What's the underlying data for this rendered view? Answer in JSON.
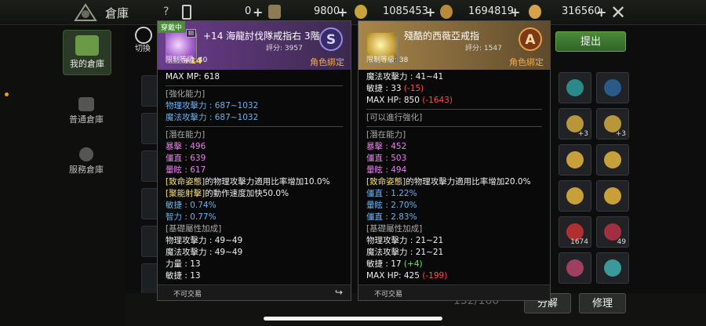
{
  "topbar": {
    "title": "倉庫",
    "help": "?",
    "resources": [
      {
        "value": "0",
        "color": "#b8a27a"
      },
      {
        "value": "9800",
        "color": "#d8b24a"
      },
      {
        "value": "1085453",
        "color": "#c9a24a"
      },
      {
        "value": "1694819",
        "color": "#d4a24c"
      },
      {
        "value": "316560",
        "color": "#cfa04a"
      }
    ]
  },
  "sidebar": {
    "switch_label": "切換",
    "items": [
      {
        "label": "我的倉庫",
        "icon": "crate-icon"
      },
      {
        "label": "普通倉庫",
        "icon": "building-icon"
      },
      {
        "label": "服務倉庫",
        "icon": "plus-circle-icon"
      }
    ]
  },
  "right_grid": {
    "counts": [
      "+3",
      "+3",
      "1674",
      "49"
    ]
  },
  "bottom": {
    "counter": "152/160",
    "withdraw_label": "提出",
    "dismantle_label": "分解",
    "repair_label": "修理"
  },
  "left_panel": {
    "equipped": "穿戴中",
    "tier": "III",
    "plus": "+14",
    "name": "+14 海龍討伐隊戒指右 3階",
    "score": "評分: 3957",
    "grade": "S",
    "req": "限制等級:  40",
    "bind": "角色綁定",
    "lines": [
      {
        "text": "MAX MP:  618",
        "color": "white"
      },
      {
        "sep": true
      },
      {
        "text": "[強化能力]",
        "color": "grey"
      },
      {
        "text": "物理攻擊力 : 687~1032",
        "color": "blue"
      },
      {
        "text": "魔法攻擊力 : 687~1032",
        "color": "blue"
      },
      {
        "sep": true
      },
      {
        "text": "[潛在能力]",
        "color": "grey"
      },
      {
        "text": "暴擊 : 496",
        "color": "pink"
      },
      {
        "text": "僵直 : 639",
        "color": "pink"
      },
      {
        "text": "暈眩 : 617",
        "color": "pink"
      },
      {
        "text": "[致命姿態]",
        "color": "yellow",
        "rest": "的物理攻擊力適用比率增加10.0%",
        "rest_color": "white"
      },
      {
        "text": "[聚能射擊]",
        "color": "yellow",
        "rest": "的動作速度加快50.0%",
        "rest_color": "white"
      },
      {
        "text": "敏捷 : 0.74%",
        "color": "blue"
      },
      {
        "text": "智力 : 0.77%",
        "color": "blue"
      },
      {
        "text": "[基礎屬性加成]",
        "color": "grey"
      },
      {
        "text": "物理攻擊力 : 49~49",
        "color": "white"
      },
      {
        "text": "魔法攻擊力 : 49~49",
        "color": "white"
      },
      {
        "text": "力量 : 13",
        "color": "white"
      },
      {
        "text": "敏捷 : 13",
        "color": "white"
      }
    ],
    "foot": "不可交易"
  },
  "right_panel": {
    "name": "殘酷的西薇亞戒指",
    "score": "評分: 1547",
    "grade": "A",
    "req": "限制等級:  38",
    "bind": "角色綁定",
    "lines": [
      {
        "text": "魔法攻擊力 : 41~41",
        "color": "white"
      },
      {
        "text": "敏捷 : 33 ",
        "color": "white",
        "rest": "(-15)",
        "rest_color": "red"
      },
      {
        "text": "MAX HP:  850 ",
        "color": "white",
        "rest": "(-1643)",
        "rest_color": "red"
      },
      {
        "sep": true
      },
      {
        "text": "[可以進行強化]",
        "color": "grey"
      },
      {
        "sep": true
      },
      {
        "text": "[潛在能力]",
        "color": "grey"
      },
      {
        "text": "暴擊 : 452",
        "color": "pink"
      },
      {
        "text": "僵直 : 503",
        "color": "pink"
      },
      {
        "text": "暈眩 : 494",
        "color": "pink"
      },
      {
        "text": "[致命姿態]",
        "color": "yellow",
        "rest": "的物理攻擊力適用比率增加20.0%",
        "rest_color": "white"
      },
      {
        "text": "僵直 : 1.22%",
        "color": "blue"
      },
      {
        "text": "暈眩 : 2.70%",
        "color": "blue"
      },
      {
        "text": "僵直 : 2.83%",
        "color": "blue"
      },
      {
        "text": "[基礎屬性加成]",
        "color": "grey"
      },
      {
        "text": "物理攻擊力 : 21~21",
        "color": "white"
      },
      {
        "text": "魔法攻擊力 : 21~21",
        "color": "white"
      },
      {
        "text": "敏捷 : 17 ",
        "color": "white",
        "rest": "(+4)",
        "rest_color": "green"
      },
      {
        "text": "MAX HP:  425 ",
        "color": "white",
        "rest": "(-199)",
        "rest_color": "red"
      }
    ],
    "foot": "不可交易"
  }
}
